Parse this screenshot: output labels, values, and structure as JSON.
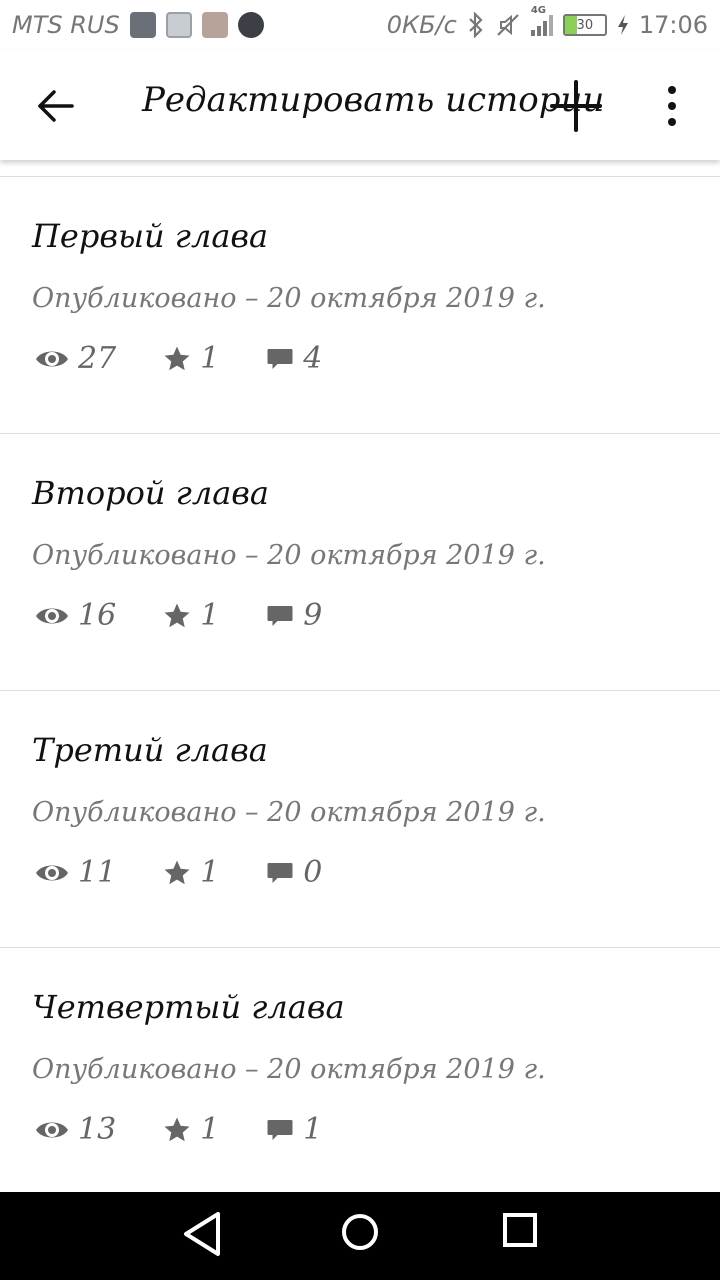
{
  "status_bar": {
    "carrier": "MTS RUS",
    "speed": "0КБ/с",
    "network": "4G",
    "battery_percent": "30",
    "time": "17:06",
    "battery_color": "#8ccf5a"
  },
  "app_bar": {
    "title": "Редактировать истории",
    "back_icon": "arrow-left-icon",
    "add_icon": "plus-icon",
    "more_icon": "more-vertical-icon"
  },
  "chapters": [
    {
      "title": "Первый глава",
      "meta": "Опубликовано – 20 октября 2019 г.",
      "views": "27",
      "stars": "1",
      "comments": "4"
    },
    {
      "title": "Второй глава",
      "meta": "Опубликовано – 20 октября 2019 г.",
      "views": "16",
      "stars": "1",
      "comments": "9"
    },
    {
      "title": "Третий глава",
      "meta": "Опубликовано – 20 октября 2019 г.",
      "views": "11",
      "stars": "1",
      "comments": "0"
    },
    {
      "title": "Четвертый глава",
      "meta": "Опубликовано – 20 октября 2019 г.",
      "views": "13",
      "stars": "1",
      "comments": "1"
    }
  ],
  "nav_bar": {
    "back_icon": "triangle-back-icon",
    "home_icon": "circle-home-icon",
    "recent_icon": "square-recents-icon"
  }
}
